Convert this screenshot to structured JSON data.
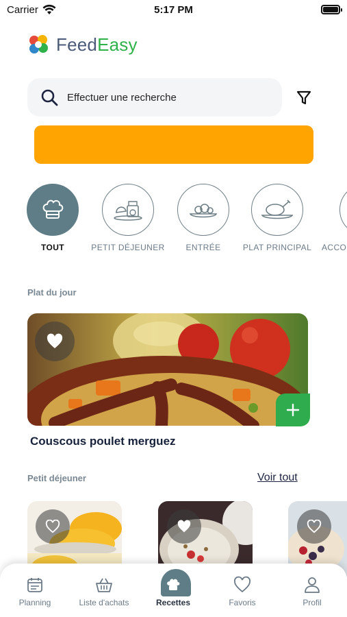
{
  "status_bar": {
    "carrier": "Carrier",
    "time": "5:17 PM"
  },
  "brand": {
    "name_part1": "Feed",
    "name_part2": "Easy",
    "color_part1": "#4a5a78",
    "color_part2": "#2fb24a"
  },
  "search": {
    "placeholder": "Effectuer une recherche"
  },
  "banner": {
    "color": "#ffa400"
  },
  "categories": [
    {
      "label": "TOUT",
      "icon": "chef-hat-icon",
      "active": true
    },
    {
      "label": "PETIT DÉJEUNER",
      "icon": "breakfast-icon",
      "active": false
    },
    {
      "label": "ENTRÉE",
      "icon": "starter-plate-icon",
      "active": false
    },
    {
      "label": "PLAT PRINCIPAL",
      "icon": "roast-chicken-icon",
      "active": false
    },
    {
      "label": "ACCO",
      "icon": "side-dish-icon",
      "active": false
    }
  ],
  "plat_du_jour": {
    "section_title": "Plat du jour",
    "dish_name": "Couscous poulet merguez"
  },
  "petit_dejeuner": {
    "section_title": "Petit déjeuner",
    "see_all_label": "Voir tout"
  },
  "tabbar": [
    {
      "label": "Planning",
      "icon": "calendar-icon"
    },
    {
      "label": "Liste d'achats",
      "icon": "basket-icon"
    },
    {
      "label": "Recettes",
      "icon": "chef-hat-icon",
      "active": true
    },
    {
      "label": "Favoris",
      "icon": "heart-icon"
    },
    {
      "label": "Profil",
      "icon": "profile-icon"
    }
  ],
  "colors": {
    "accent_green": "#2eac4e",
    "active_slate": "#5f7d86"
  }
}
